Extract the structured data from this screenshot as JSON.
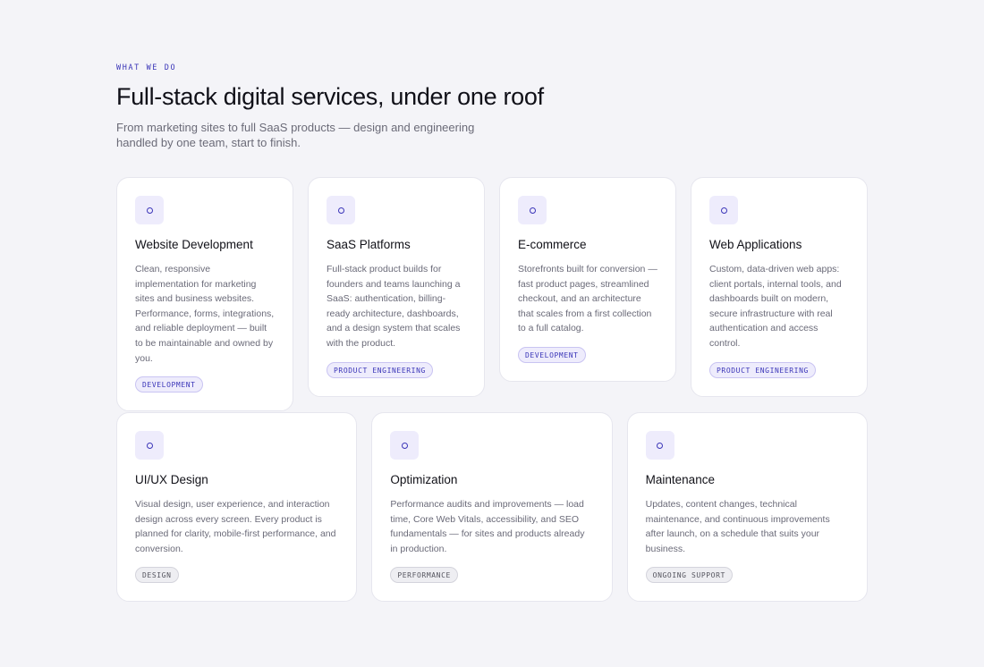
{
  "section": {
    "eyebrow": "WHAT WE DO",
    "title": "Full-stack digital services, under one roof",
    "description": "From marketing sites to full SaaS products — design and engineering handled by one team, start to finish."
  },
  "colors": {
    "accent": "#3b36b8",
    "icon_bg": "#eeecfc",
    "page_bg": "#f4f4f8",
    "card_bg": "#ffffff"
  },
  "services": [
    {
      "icon": "circle-icon",
      "title": "Website Development",
      "description": "Clean, responsive implementation for marketing sites and business websites. Performance, forms, integrations, and reliable deployment — built to be maintainable and owned by you.",
      "tag": "DEVELOPMENT"
    },
    {
      "icon": "circle-icon",
      "title": "SaaS Platforms",
      "description": "Full-stack product builds for founders and teams launching a SaaS: authentication, billing-ready architecture, dashboards, and a design system that scales with the product.",
      "tag": "PRODUCT ENGINEERING"
    },
    {
      "icon": "circle-icon",
      "title": "E-commerce",
      "description": "Storefronts built for conversion — fast product pages, streamlined checkout, and an architecture that scales from a first collection to a full catalog.",
      "tag": "DEVELOPMENT"
    },
    {
      "icon": "circle-icon",
      "title": "Web Applications",
      "description": "Custom, data-driven web apps: client portals, internal tools, and dashboards built on modern, secure infrastructure with real authentication and access control.",
      "tag": "PRODUCT ENGINEERING"
    },
    {
      "icon": "circle-icon",
      "title": "UI/UX Design",
      "description": "Visual design, user experience, and interaction design across every screen. Every product is planned for clarity, mobile-first performance, and conversion.",
      "tag": "DESIGN"
    },
    {
      "icon": "circle-icon",
      "title": "Optimization",
      "description": "Performance audits and improvements — load time, Core Web Vitals, accessibility, and SEO fundamentals — for sites and products already in production.",
      "tag": "PERFORMANCE"
    },
    {
      "icon": "circle-icon",
      "title": "Maintenance",
      "description": "Updates, content changes, technical maintenance, and continuous improvements after launch, on a schedule that suits your business.",
      "tag": "ONGOING SUPPORT"
    }
  ]
}
